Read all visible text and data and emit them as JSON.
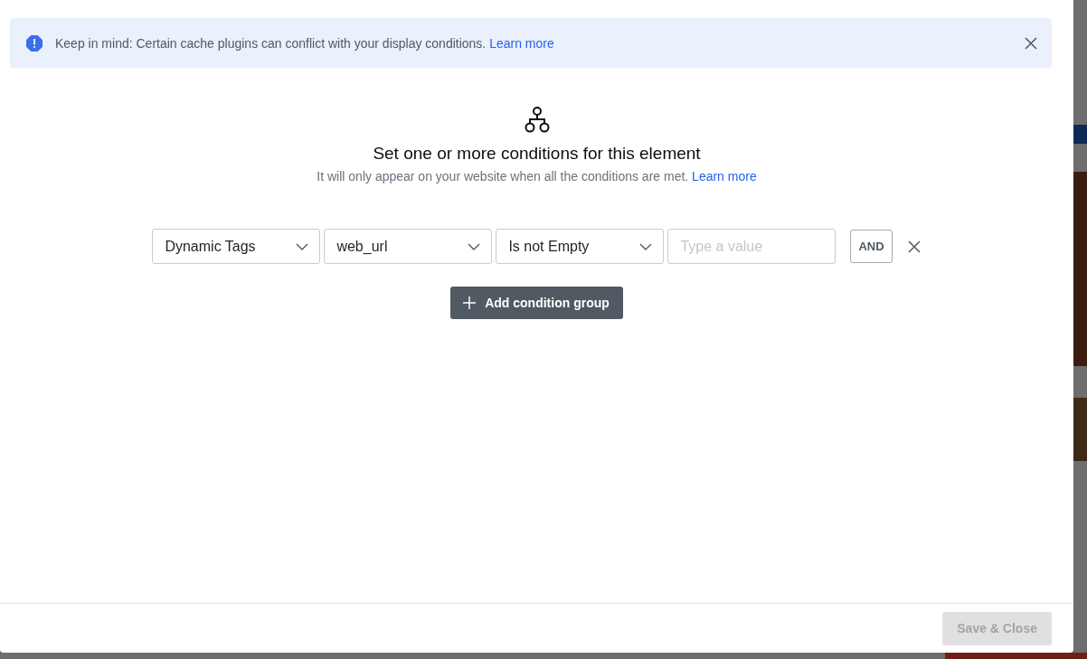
{
  "notice": {
    "text": "Keep in mind: Certain cache plugins can conflict with your display conditions.",
    "link": "Learn more"
  },
  "header": {
    "title": "Set one or more conditions for this element",
    "subtitle": "It will only appear on your website when all the conditions are met.",
    "link": "Learn more"
  },
  "conditions": [
    {
      "fields": [
        {
          "kind": "select",
          "value": "Dynamic Tags"
        },
        {
          "kind": "select",
          "value": "web_url"
        },
        {
          "kind": "select",
          "value": "Is not Empty"
        },
        {
          "kind": "input",
          "placeholder": "Type a value"
        }
      ],
      "operator": "AND"
    }
  ],
  "add_group_button": "Add condition group",
  "footer": {
    "save_button": {
      "label": "Save & Close",
      "disabled": true
    }
  }
}
